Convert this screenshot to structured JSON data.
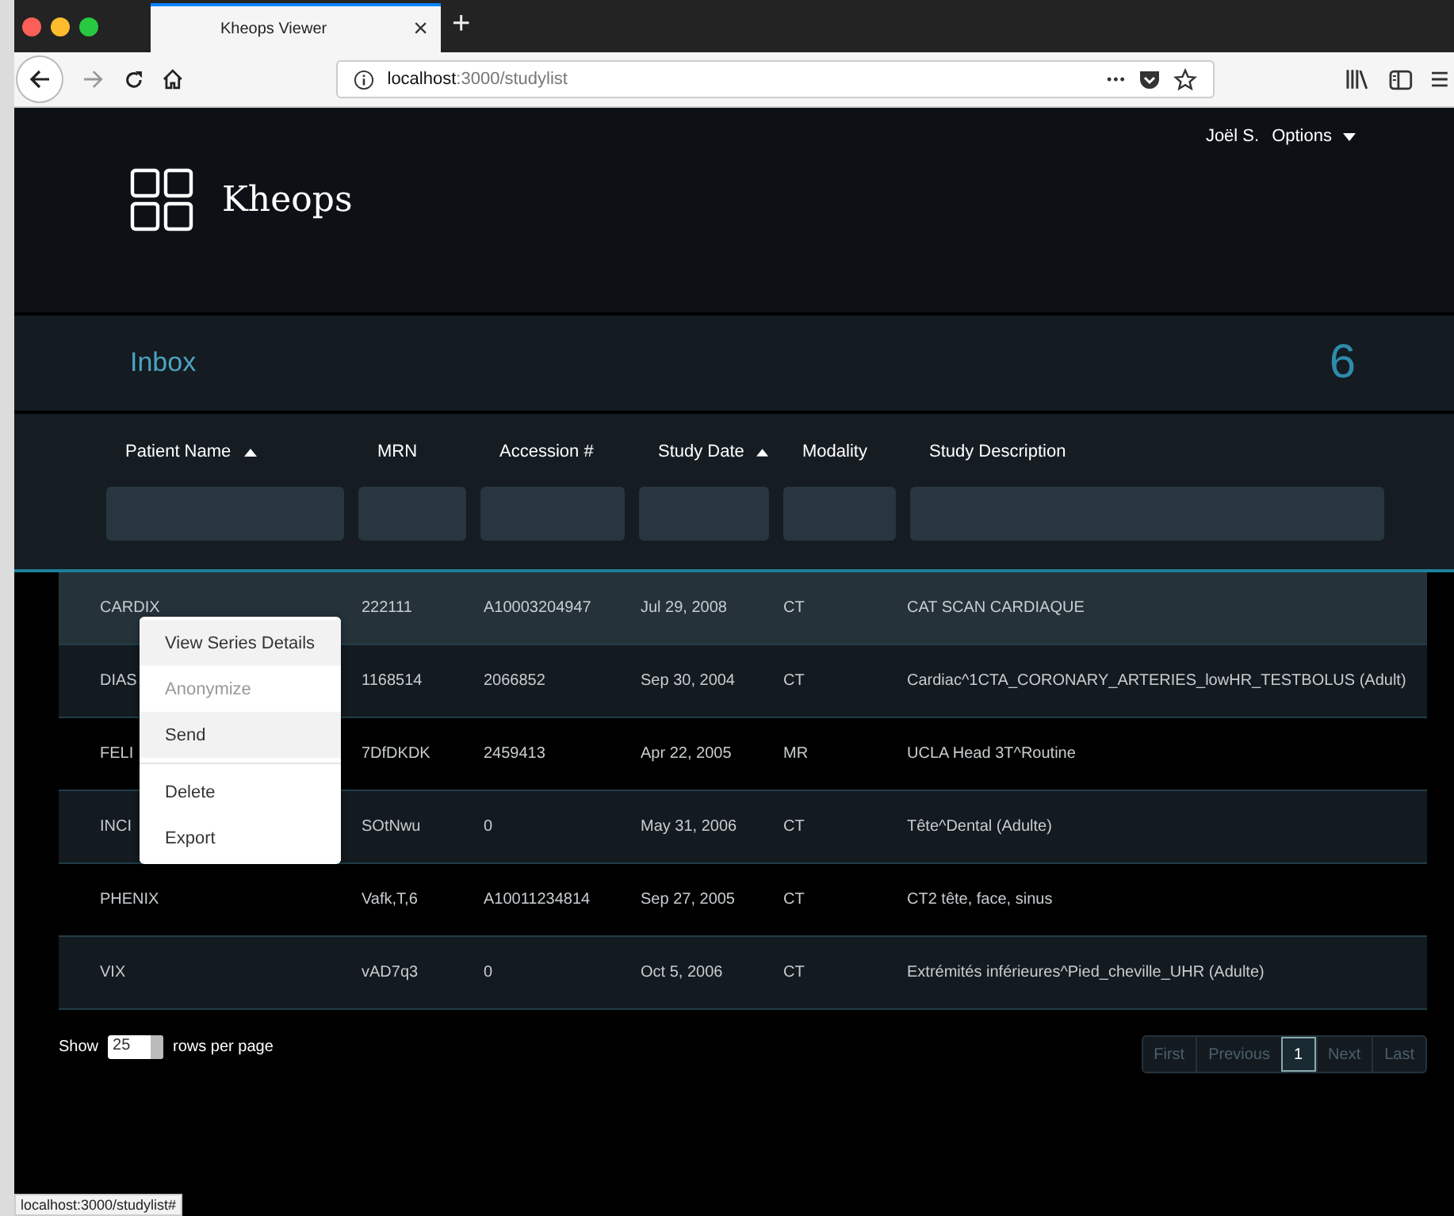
{
  "browser": {
    "tab_title": "Kheops Viewer",
    "close": "×",
    "new_tab": "+",
    "url_host": "localhost",
    "url_path": ":3000/studylist",
    "more": "•••"
  },
  "header": {
    "brand": "Kheops",
    "user": "Joël S.",
    "options": "Options"
  },
  "inbox": {
    "title": "Inbox",
    "count": "6"
  },
  "columns": [
    {
      "label": "Patient Name",
      "sort_ascending": true
    },
    {
      "label": "MRN",
      "sort_ascending": false
    },
    {
      "label": "Accession #",
      "sort_ascending": false
    },
    {
      "label": "Study Date",
      "sort_ascending": true
    },
    {
      "label": "Modality",
      "sort_ascending": false
    },
    {
      "label": "Study Description",
      "sort_ascending": false
    }
  ],
  "rows": [
    {
      "cells": [
        "CARDIX",
        "222111",
        "A10003204947",
        "Jul 29, 2008",
        "CT",
        "CAT SCAN CARDIAQUE"
      ],
      "selected": true
    },
    {
      "cells": [
        "DIAS",
        "1168514",
        "2066852",
        "Sep 30, 2004",
        "CT",
        "Cardiac^1CTA_CORONARY_ARTERIES_lowHR_TESTBOLUS (Adult)"
      ],
      "selected": false
    },
    {
      "cells": [
        "FELI",
        "7DfDKDK",
        "2459413",
        "Apr 22, 2005",
        "MR",
        "UCLA Head 3T^Routine"
      ],
      "selected": false
    },
    {
      "cells": [
        "INCI",
        "SOtNwu",
        "0",
        "May 31, 2006",
        "CT",
        "Tête^Dental (Adulte)"
      ],
      "selected": false
    },
    {
      "cells": [
        "PHENIX",
        "Vafk,T,6",
        "A10011234814",
        "Sep 27, 2005",
        "CT",
        "CT2 tête, face, sinus"
      ],
      "selected": false
    },
    {
      "cells": [
        "VIX",
        "vAD7q3",
        "0",
        "Oct 5, 2006",
        "CT",
        "Extrémités inférieures^Pied_cheville_UHR (Adulte)"
      ],
      "selected": false
    }
  ],
  "context_menu": [
    {
      "label": "View Series Details",
      "highlighted": true,
      "disabled": false,
      "separator_before": false
    },
    {
      "label": "Anonymize",
      "highlighted": false,
      "disabled": true,
      "separator_before": false
    },
    {
      "label": "Send",
      "highlighted": true,
      "disabled": false,
      "separator_before": false
    },
    {
      "label": "Delete",
      "highlighted": false,
      "disabled": false,
      "separator_before": true
    },
    {
      "label": "Export",
      "highlighted": false,
      "disabled": false,
      "separator_before": false
    }
  ],
  "page_size": {
    "show": "Show",
    "value": "25",
    "suffix": "rows per page"
  },
  "pagination": [
    {
      "label": "First",
      "selected": false
    },
    {
      "label": "Previous",
      "selected": false
    },
    {
      "label": "1",
      "selected": true
    },
    {
      "label": "Next",
      "selected": false
    },
    {
      "label": "Last",
      "selected": false
    }
  ],
  "status_bar": "localhost:3000/studylist#"
}
